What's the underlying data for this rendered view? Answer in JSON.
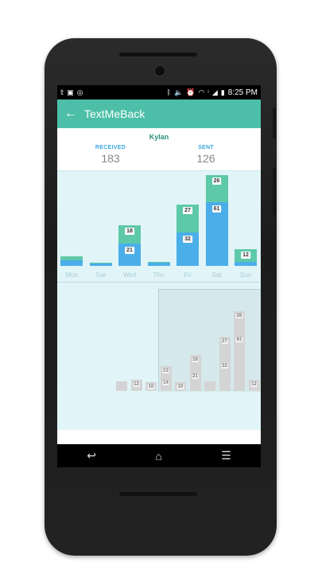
{
  "status_bar": {
    "time": "8:25 PM",
    "left_icons": [
      "twitter-icon",
      "image-icon",
      "voicemail-icon"
    ],
    "right_icons": [
      "bluetooth-icon",
      "volume-icon",
      "alarm-icon",
      "wifi-icon",
      "lte-icon",
      "signal-icon",
      "battery-icon"
    ]
  },
  "app_bar": {
    "title": "TextMeBack",
    "back_icon": "arrow-left-icon"
  },
  "contact": {
    "name": "Kylan"
  },
  "stats": {
    "received_label": "RECEIVED",
    "received_value": "183",
    "sent_label": "SENT",
    "sent_value": "126"
  },
  "colors": {
    "accent": "#4dbfa8",
    "sent": "#5ec9a8",
    "received": "#4aaee8",
    "background": "#e1f4f8"
  },
  "chart_data": [
    {
      "type": "bar",
      "stacked": true,
      "categories": [
        "Mon",
        "Tue",
        "Wed",
        "Thu",
        "Fri",
        "Sat",
        "Sun"
      ],
      "series": [
        {
          "name": "received",
          "values": [
            5,
            2,
            21,
            3,
            32,
            61,
            4
          ]
        },
        {
          "name": "sent",
          "values": [
            4,
            1,
            18,
            1,
            27,
            26,
            12
          ]
        }
      ],
      "data_labels": [
        {
          "day": "Wed",
          "received": "21",
          "sent": "18"
        },
        {
          "day": "Fri",
          "received": "32",
          "sent": "27"
        },
        {
          "day": "Sat",
          "received": "61",
          "sent": "26"
        },
        {
          "day": "Sun",
          "sent": "12"
        }
      ]
    },
    {
      "type": "bar",
      "stacked": true,
      "values_lower": [
        0,
        12,
        10,
        14,
        10,
        21,
        0,
        32,
        61,
        12
      ],
      "values_upper": [
        0,
        0,
        0,
        13,
        0,
        18,
        0,
        27,
        26,
        0
      ],
      "labels_lower": [
        "",
        "12",
        "10",
        "14",
        "10",
        "21",
        "",
        "32",
        "61",
        "12"
      ],
      "labels_upper": [
        "",
        "",
        "",
        "13",
        "",
        "18",
        "",
        "27",
        "26",
        ""
      ]
    }
  ],
  "nav_bar": {
    "back_icon": "nav-back-icon",
    "home_icon": "nav-home-icon",
    "recents_icon": "nav-recents-icon"
  }
}
